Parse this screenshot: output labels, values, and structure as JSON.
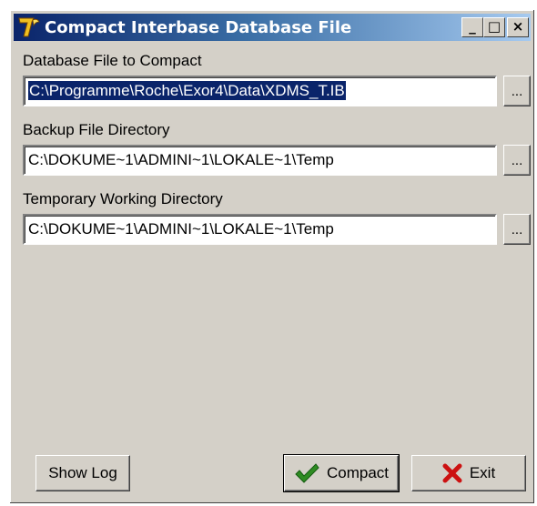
{
  "window": {
    "title": "Compact Interbase Database File",
    "app_icon": "app-logo-7-icon",
    "caption_buttons": {
      "minimize": "_",
      "maximize": "□",
      "close": "×"
    }
  },
  "fields": {
    "database_file": {
      "label": "Database File to Compact",
      "value": "C:\\Programme\\Roche\\Exor4\\Data\\XDMS_T.IB",
      "browse_label": "..."
    },
    "backup_dir": {
      "label": "Backup File Directory",
      "value": "C:\\DOKUME~1\\ADMINI~1\\LOKALE~1\\Temp",
      "browse_label": "..."
    },
    "temp_dir": {
      "label": "Temporary Working Directory",
      "value": "C:\\DOKUME~1\\ADMINI~1\\LOKALE~1\\Temp",
      "browse_label": "..."
    }
  },
  "buttons": {
    "show_log": "Show Log",
    "compact": "Compact",
    "compact_icon": "green-checkmark-icon",
    "exit": "Exit",
    "exit_icon": "red-x-icon"
  },
  "colors": {
    "titlebar_start": "#0a246a",
    "titlebar_end": "#a6caf0",
    "dialog_bg": "#d4d0c8",
    "selection": "#0a246a",
    "check_green": "#2e8b22",
    "exit_red": "#cc1111"
  }
}
